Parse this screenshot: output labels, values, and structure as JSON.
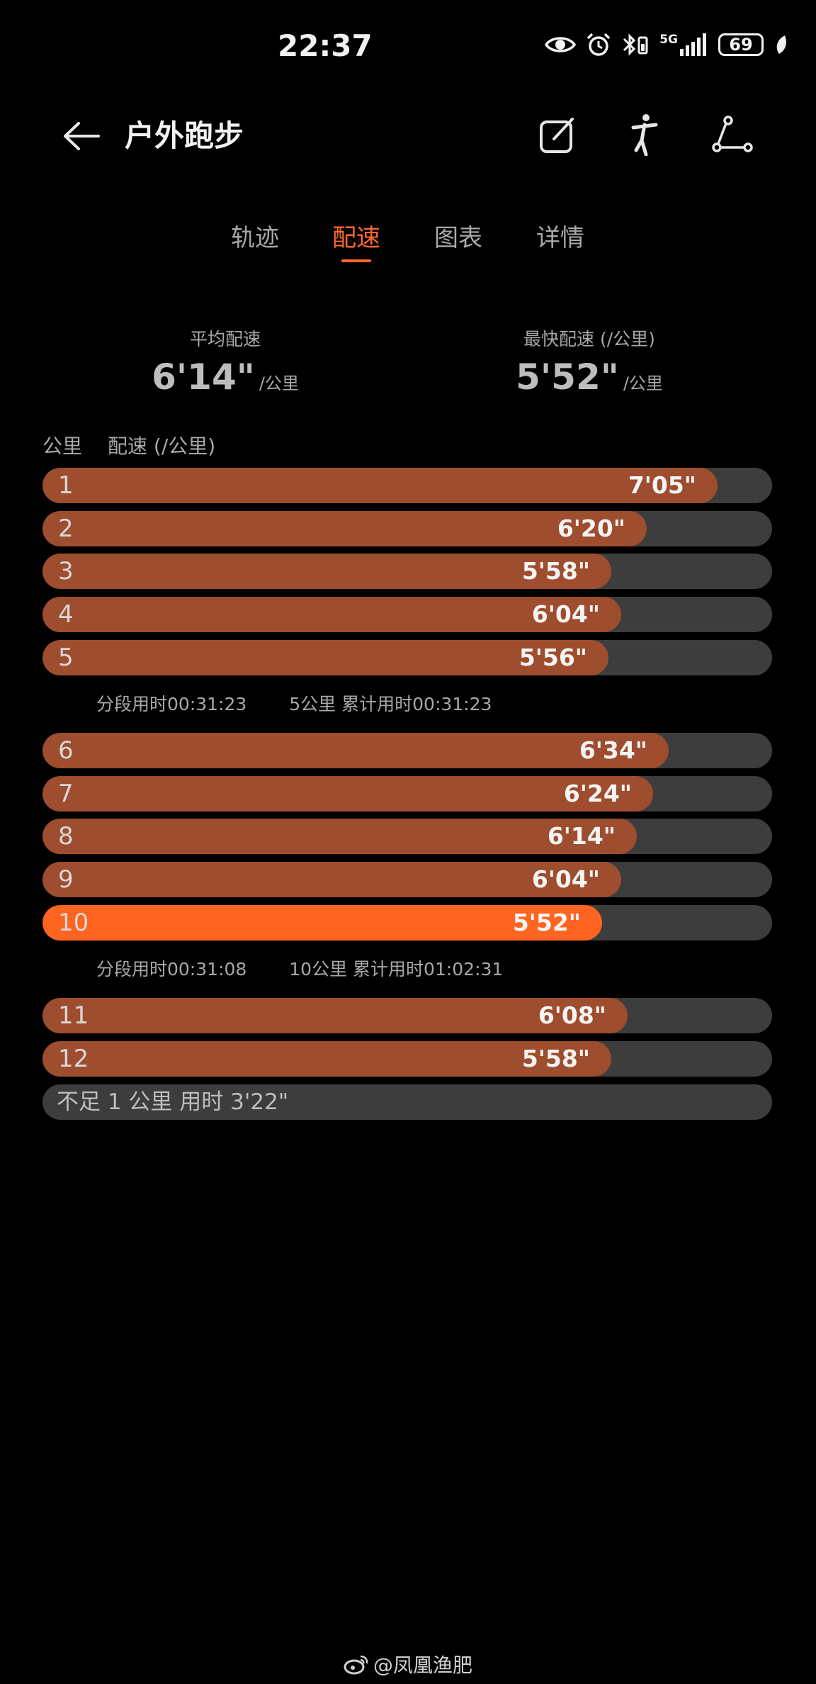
{
  "status_bar": {
    "time": "22:37",
    "network": "5G",
    "battery": "69"
  },
  "header": {
    "title": "户外跑步"
  },
  "tabs": [
    {
      "label": "轨迹",
      "active": false
    },
    {
      "label": "配速",
      "active": true
    },
    {
      "label": "图表",
      "active": false
    },
    {
      "label": "详情",
      "active": false
    }
  ],
  "summary": {
    "avg_label": "平均配速",
    "avg_value": "6'14\"",
    "avg_unit": "/公里",
    "fast_label": "最快配速 (/公里)",
    "fast_value": "5'52\"",
    "fast_unit": "/公里"
  },
  "list_header": {
    "km": "公里",
    "pace": "配速 (/公里)"
  },
  "splits": [
    {
      "km": "1",
      "pace": "7'05\"",
      "fill": 0.925
    },
    {
      "km": "2",
      "pace": "6'20\"",
      "fill": 0.828
    },
    {
      "km": "3",
      "pace": "5'58\"",
      "fill": 0.78
    },
    {
      "km": "4",
      "pace": "6'04\"",
      "fill": 0.793
    },
    {
      "km": "5",
      "pace": "5'56\"",
      "fill": 0.776
    },
    {
      "km": "6",
      "pace": "6'34\"",
      "fill": 0.858
    },
    {
      "km": "7",
      "pace": "6'24\"",
      "fill": 0.837
    },
    {
      "km": "8",
      "pace": "6'14\"",
      "fill": 0.815
    },
    {
      "km": "9",
      "pace": "6'04\"",
      "fill": 0.793
    },
    {
      "km": "10",
      "pace": "5'52\"",
      "fill": 0.767,
      "fastest": true
    },
    {
      "km": "11",
      "pace": "6'08\"",
      "fill": 0.802
    },
    {
      "km": "12",
      "pace": "5'58\"",
      "fill": 0.78
    }
  ],
  "segments": [
    {
      "split_time": "分段用时00:31:23",
      "cumulative": "5公里 累计用时00:31:23"
    },
    {
      "split_time": "分段用时00:31:08",
      "cumulative": "10公里 累计用时01:02:31"
    }
  ],
  "remainder": {
    "text": "不足 1 公里 用时 3'22\""
  },
  "watermark": {
    "text": "@凤凰渔肥"
  },
  "colors": {
    "accent": "#ff6a2b",
    "bar_fill": "#9e4d2e",
    "bar_fastest": "#ff6420",
    "bar_track": "#3d3d3d"
  }
}
